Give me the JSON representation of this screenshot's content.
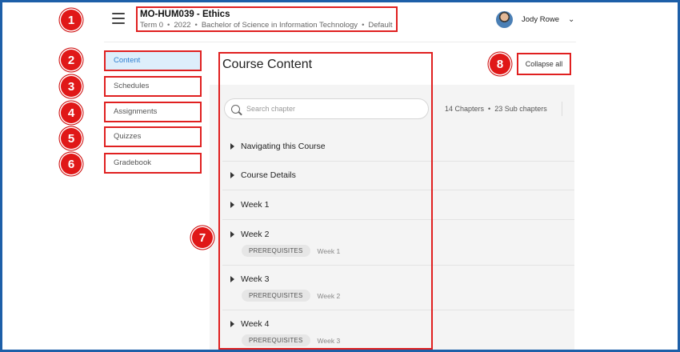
{
  "header": {
    "course_title": "MO-HUM039 - Ethics",
    "meta": [
      "Term 0",
      "2022",
      "Bachelor of Science in Information Technology",
      "Default"
    ],
    "user_name": "Jody Rowe"
  },
  "sidebar": {
    "items": [
      {
        "label": "Content",
        "active": true
      },
      {
        "label": "Schedules",
        "active": false
      },
      {
        "label": "Assignments",
        "active": false
      },
      {
        "label": "Quizzes",
        "active": false
      },
      {
        "label": "Gradebook",
        "active": false
      }
    ]
  },
  "main": {
    "title": "Course Content",
    "collapse_label": "Collapse all",
    "search_placeholder": "Search chapter",
    "chapters_count": "14 Chapters",
    "subchapters_count": "23 Sub chapters",
    "chapters": [
      {
        "title": "Navigating this Course"
      },
      {
        "title": "Course Details"
      },
      {
        "title": "Week 1"
      },
      {
        "title": "Week 2",
        "prereq_label": "PREREQUISITES",
        "prereq_week": "Week 1"
      },
      {
        "title": "Week 3",
        "prereq_label": "PREREQUISITES",
        "prereq_week": "Week 2"
      },
      {
        "title": "Week 4",
        "prereq_label": "PREREQUISITES",
        "prereq_week": "Week 3"
      }
    ]
  },
  "annotations": [
    "1",
    "2",
    "3",
    "4",
    "5",
    "6",
    "7",
    "8"
  ],
  "colors": {
    "annotation_red": "#e02020",
    "frame_blue": "#1d5fa8",
    "active_nav_bg": "#ddeefb",
    "active_nav_text": "#2f7fd0"
  }
}
